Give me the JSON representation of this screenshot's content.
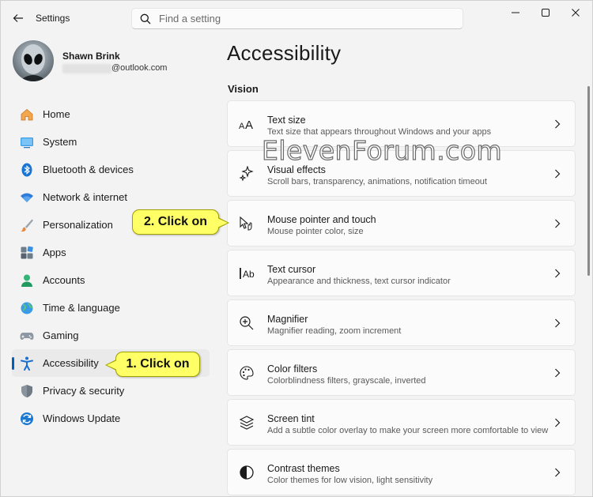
{
  "window": {
    "title": "Settings"
  },
  "search": {
    "placeholder": "Find a setting"
  },
  "profile": {
    "name": "Shawn Brink",
    "email_suffix": "@outlook.com"
  },
  "sidebar": {
    "items": [
      {
        "label": "Home",
        "icon": "home-icon",
        "color": "#e8912d"
      },
      {
        "label": "System",
        "icon": "system-icon",
        "color": "#2a8ad4"
      },
      {
        "label": "Bluetooth & devices",
        "icon": "bluetooth-icon",
        "color": "#0a6cc4"
      },
      {
        "label": "Network & internet",
        "icon": "wifi-icon",
        "color": "#2f7bd9"
      },
      {
        "label": "Personalization",
        "icon": "brush-icon",
        "color": "#d9843a"
      },
      {
        "label": "Apps",
        "icon": "apps-icon",
        "color": "#5a6b7a"
      },
      {
        "label": "Accounts",
        "icon": "accounts-icon",
        "color": "#2ea56a"
      },
      {
        "label": "Time & language",
        "icon": "globe-icon",
        "color": "#2a8ad4"
      },
      {
        "label": "Gaming",
        "icon": "gamepad-icon",
        "color": "#7a8590"
      },
      {
        "label": "Accessibility",
        "icon": "accessibility-icon",
        "color": "#1b6fd1",
        "active": true
      },
      {
        "label": "Privacy & security",
        "icon": "shield-icon",
        "color": "#7b8591"
      },
      {
        "label": "Windows Update",
        "icon": "update-icon",
        "color": "#1b78d1"
      }
    ]
  },
  "main": {
    "title": "Accessibility",
    "section": "Vision",
    "cards": [
      {
        "title": "Text size",
        "desc": "Text size that appears throughout Windows and your apps",
        "icon": "text-size-icon"
      },
      {
        "title": "Visual effects",
        "desc": "Scroll bars, transparency, animations, notification timeout",
        "icon": "sparkle-icon"
      },
      {
        "title": "Mouse pointer and touch",
        "desc": "Mouse pointer color, size",
        "icon": "pointer-icon"
      },
      {
        "title": "Text cursor",
        "desc": "Appearance and thickness, text cursor indicator",
        "icon": "text-cursor-icon"
      },
      {
        "title": "Magnifier",
        "desc": "Magnifier reading, zoom increment",
        "icon": "magnifier-icon"
      },
      {
        "title": "Color filters",
        "desc": "Colorblindness filters, grayscale, inverted",
        "icon": "palette-icon"
      },
      {
        "title": "Screen tint",
        "desc": "Add a subtle color overlay to make your screen more comfortable to view",
        "icon": "layers-icon"
      },
      {
        "title": "Contrast themes",
        "desc": "Color themes for low vision, light sensitivity",
        "icon": "contrast-icon"
      }
    ]
  },
  "annotations": {
    "callout1": "1. Click on",
    "callout2": "2. Click on",
    "watermark": "ElevenForum.com",
    "callout_color": "#ffff66"
  }
}
